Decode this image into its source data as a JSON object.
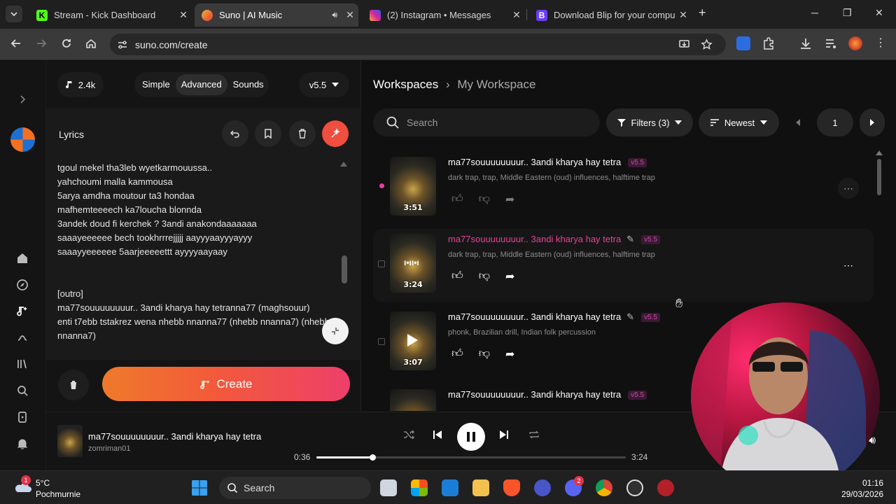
{
  "browser": {
    "tabs": [
      {
        "title": "Stream - Kick Dashboard",
        "color": "#53fc18"
      },
      {
        "title": "Suno | AI Music",
        "color": "#f0b042",
        "active": true
      },
      {
        "title": "(2) Instagram • Messages",
        "color": "#d6249f"
      },
      {
        "title": "Download Blip for your comput",
        "color": "#6a3df5"
      }
    ],
    "new_tab": "+",
    "url": "suno.com/create"
  },
  "create": {
    "credits": "2.4k",
    "modes": [
      "Simple",
      "Advanced",
      "Sounds"
    ],
    "version": "v5.5",
    "lyrics_label": "Lyrics",
    "lyrics": "tgoul mekel tha3leb wyetkarmouussa..\nyahchoumi malla kammousa\n5arya amdha moutour ta3 hondaa\nmafhemteeeech ka7loucha blonnda\n3andek doud fi kerchek ? 3andi anakondaaaaaaa\nsaaayeeeeee bech tookhrrrejjjjj aayyyaayyyayyy\nsaaayyeeeeee 5aarjeeeeettt ayyyyaayaay\n\n\n[outro]\nma77souuuuuuuur.. 3andi kharya hay tetranna77 (maghsouur)\nenti t7ebb tstakrez wena nhebb nnanna77 (nhebb nnanna7) (nhebb\nnnanna7)",
    "create_label": "Create"
  },
  "workspace": {
    "root": "Workspaces",
    "current": "My Workspace",
    "search_placeholder": "Search",
    "filters": "Filters (3)",
    "sort": "Newest",
    "page": "1",
    "songs": [
      {
        "title": "ma77souuuuuuuur.. 3andi kharya hay tetra",
        "tags": "dark trap, trap, Middle Eastern (oud) influences, halftime trap",
        "duration": "3:51",
        "version": "v5.5",
        "playing": true
      },
      {
        "title": "ma77souuuuuuuur.. 3andi kharya hay tetra",
        "tags": "dark trap, trap, Middle Eastern (oud) influences, halftime trap",
        "duration": "3:24",
        "version": "v5.5",
        "highlighted": true
      },
      {
        "title": "ma77souuuuuuuur.. 3andi kharya hay tetra",
        "tags": "phonk, Brazilian drill, Indian folk percussion",
        "duration": "3:07",
        "version": "v5.5"
      },
      {
        "title": "ma77souuuuuuuur.. 3andi kharya hay tetra",
        "tags": "",
        "duration": "",
        "version": "v5.5"
      }
    ]
  },
  "player": {
    "title": "ma77souuuuuuuur.. 3andi kharya hay tetra",
    "artist": "zomriman01",
    "elapsed": "0:36",
    "total": "3:24",
    "progress": 0.18
  },
  "taskbar": {
    "temperature": "5°C",
    "weather": "Pochmurnie",
    "weather_alert": "1",
    "search": "Search",
    "time": "01:16",
    "date": "29/03/2026",
    "discord_badge": "2"
  },
  "colors": {
    "accent": "#f04e3e",
    "pink": "#e6409c",
    "badge": "#c54aa0"
  }
}
